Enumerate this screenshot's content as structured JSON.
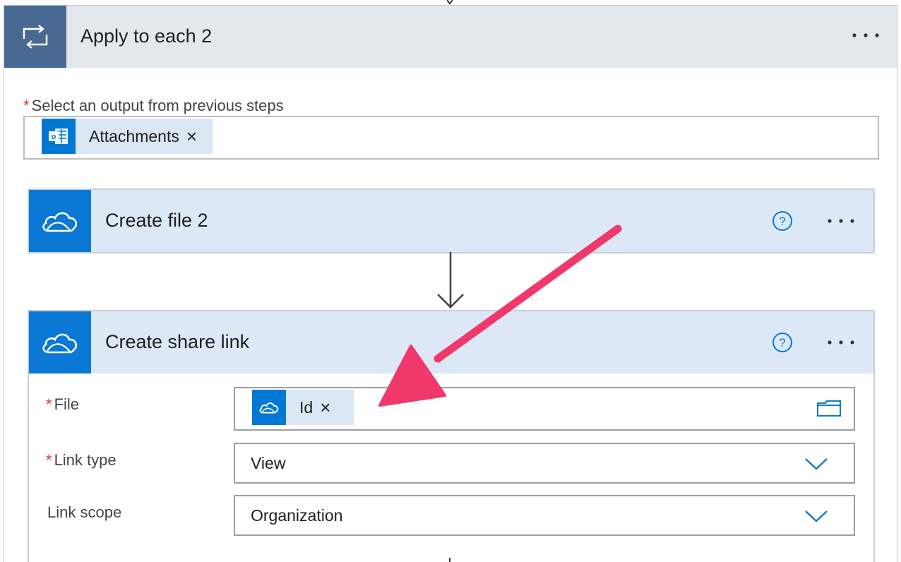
{
  "apply_to_each": {
    "title": "Apply to each 2",
    "icon": "loop-icon",
    "more_label": "···",
    "select_output_label": "Select an output from previous steps",
    "required_mark": "*",
    "token": {
      "label": "Attachments",
      "icon": "outlook-icon",
      "remove": "×"
    }
  },
  "create_file": {
    "title": "Create file 2",
    "icon": "onedrive-icon",
    "more_label": "···"
  },
  "create_share_link": {
    "title": "Create share link",
    "icon": "onedrive-icon",
    "more_label": "···",
    "fields": {
      "file": {
        "label": "File",
        "required": "*",
        "token_label": "Id",
        "token_remove": "×"
      },
      "link_type": {
        "label": "Link type",
        "required": "*",
        "value": "View"
      },
      "link_scope": {
        "label": "Link scope",
        "value": "Organization"
      }
    }
  },
  "colors": {
    "loop_header": "#486991",
    "onedrive_blue": "#0a78d4",
    "annotation_arrow": "#f0386b",
    "required": "#d13438"
  }
}
